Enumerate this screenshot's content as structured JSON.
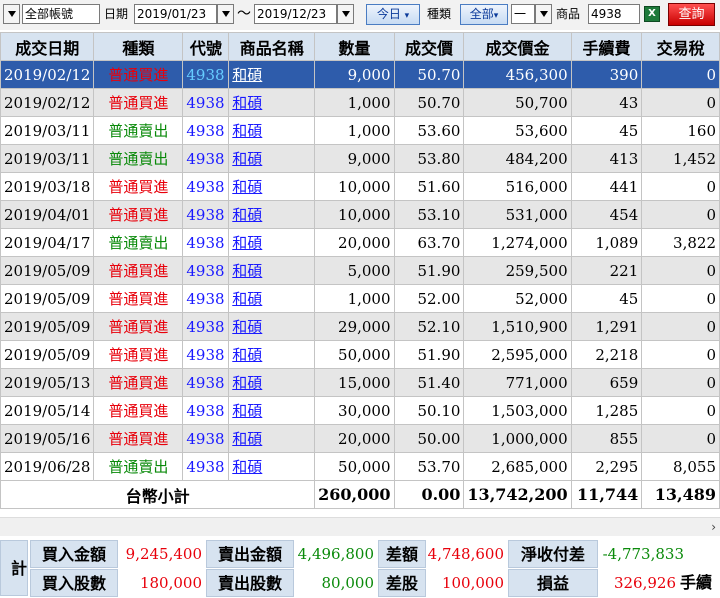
{
  "toolbar": {
    "account": "全部帳號",
    "date_label": "日期",
    "start_date": "2019/01/23",
    "tilde": "～",
    "end_date": "2019/12/23",
    "today_button": "今日",
    "type_label": "種類",
    "type_value": "全部",
    "period_value": "一",
    "product_label": "商品",
    "product_value": "4938",
    "query_button": "查詢"
  },
  "table": {
    "headers": [
      "成交日期",
      "種類",
      "代號",
      "商品名稱",
      "數量",
      "成交價",
      "成交價金",
      "手續費",
      "交易稅"
    ],
    "rows": [
      {
        "date": "2019/02/12",
        "type": "普通買進",
        "code": "4938",
        "name": "和碩",
        "qty": "9,000",
        "price": "50.70",
        "amount": "456,300",
        "fee": "390",
        "tax": "0",
        "side": "buy"
      },
      {
        "date": "2019/02/12",
        "type": "普通買進",
        "code": "4938",
        "name": "和碩",
        "qty": "1,000",
        "price": "50.70",
        "amount": "50,700",
        "fee": "43",
        "tax": "0",
        "side": "buy"
      },
      {
        "date": "2019/03/11",
        "type": "普通賣出",
        "code": "4938",
        "name": "和碩",
        "qty": "1,000",
        "price": "53.60",
        "amount": "53,600",
        "fee": "45",
        "tax": "160",
        "side": "sell"
      },
      {
        "date": "2019/03/11",
        "type": "普通賣出",
        "code": "4938",
        "name": "和碩",
        "qty": "9,000",
        "price": "53.80",
        "amount": "484,200",
        "fee": "413",
        "tax": "1,452",
        "side": "sell"
      },
      {
        "date": "2019/03/18",
        "type": "普通買進",
        "code": "4938",
        "name": "和碩",
        "qty": "10,000",
        "price": "51.60",
        "amount": "516,000",
        "fee": "441",
        "tax": "0",
        "side": "buy"
      },
      {
        "date": "2019/04/01",
        "type": "普通買進",
        "code": "4938",
        "name": "和碩",
        "qty": "10,000",
        "price": "53.10",
        "amount": "531,000",
        "fee": "454",
        "tax": "0",
        "side": "buy"
      },
      {
        "date": "2019/04/17",
        "type": "普通賣出",
        "code": "4938",
        "name": "和碩",
        "qty": "20,000",
        "price": "63.70",
        "amount": "1,274,000",
        "fee": "1,089",
        "tax": "3,822",
        "side": "sell"
      },
      {
        "date": "2019/05/09",
        "type": "普通買進",
        "code": "4938",
        "name": "和碩",
        "qty": "5,000",
        "price": "51.90",
        "amount": "259,500",
        "fee": "221",
        "tax": "0",
        "side": "buy"
      },
      {
        "date": "2019/05/09",
        "type": "普通買進",
        "code": "4938",
        "name": "和碩",
        "qty": "1,000",
        "price": "52.00",
        "amount": "52,000",
        "fee": "45",
        "tax": "0",
        "side": "buy"
      },
      {
        "date": "2019/05/09",
        "type": "普通買進",
        "code": "4938",
        "name": "和碩",
        "qty": "29,000",
        "price": "52.10",
        "amount": "1,510,900",
        "fee": "1,291",
        "tax": "0",
        "side": "buy"
      },
      {
        "date": "2019/05/09",
        "type": "普通買進",
        "code": "4938",
        "name": "和碩",
        "qty": "50,000",
        "price": "51.90",
        "amount": "2,595,000",
        "fee": "2,218",
        "tax": "0",
        "side": "buy"
      },
      {
        "date": "2019/05/13",
        "type": "普通買進",
        "code": "4938",
        "name": "和碩",
        "qty": "15,000",
        "price": "51.40",
        "amount": "771,000",
        "fee": "659",
        "tax": "0",
        "side": "buy"
      },
      {
        "date": "2019/05/14",
        "type": "普通買進",
        "code": "4938",
        "name": "和碩",
        "qty": "30,000",
        "price": "50.10",
        "amount": "1,503,000",
        "fee": "1,285",
        "tax": "0",
        "side": "buy"
      },
      {
        "date": "2019/05/16",
        "type": "普通買進",
        "code": "4938",
        "name": "和碩",
        "qty": "20,000",
        "price": "50.00",
        "amount": "1,000,000",
        "fee": "855",
        "tax": "0",
        "side": "buy"
      },
      {
        "date": "2019/06/28",
        "type": "普通賣出",
        "code": "4938",
        "name": "和碩",
        "qty": "50,000",
        "price": "53.70",
        "amount": "2,685,000",
        "fee": "2,295",
        "tax": "8,055",
        "side": "sell"
      }
    ],
    "total": {
      "label": "台幣小計",
      "qty": "260,000",
      "price": "0.00",
      "amount": "13,742,200",
      "fee": "11,744",
      "tax": "13,489"
    }
  },
  "summary": {
    "side_label": "計",
    "buy_amount_label": "買入金額",
    "buy_amount": "9,245,400",
    "sell_amount_label": "賣出金額",
    "sell_amount": "4,496,800",
    "diff_amount_label": "差額",
    "diff_amount": "4,748,600",
    "net_label": "淨收付差",
    "net_value": "-4,773,833",
    "buy_shares_label": "買入股數",
    "buy_shares": "180,000",
    "sell_shares_label": "賣出股數",
    "sell_shares": "80,000",
    "diff_shares_label": "差股",
    "diff_shares": "100,000",
    "pnl_label": "損益",
    "pnl_value": "326,926",
    "fee_label_partial": "手續"
  },
  "colors": {
    "header_bg": "#d7e3f0",
    "selected_row": "#2e5cab",
    "buy": "#e8000b",
    "sell": "#0a8a0a",
    "code": "#1a1aff"
  }
}
